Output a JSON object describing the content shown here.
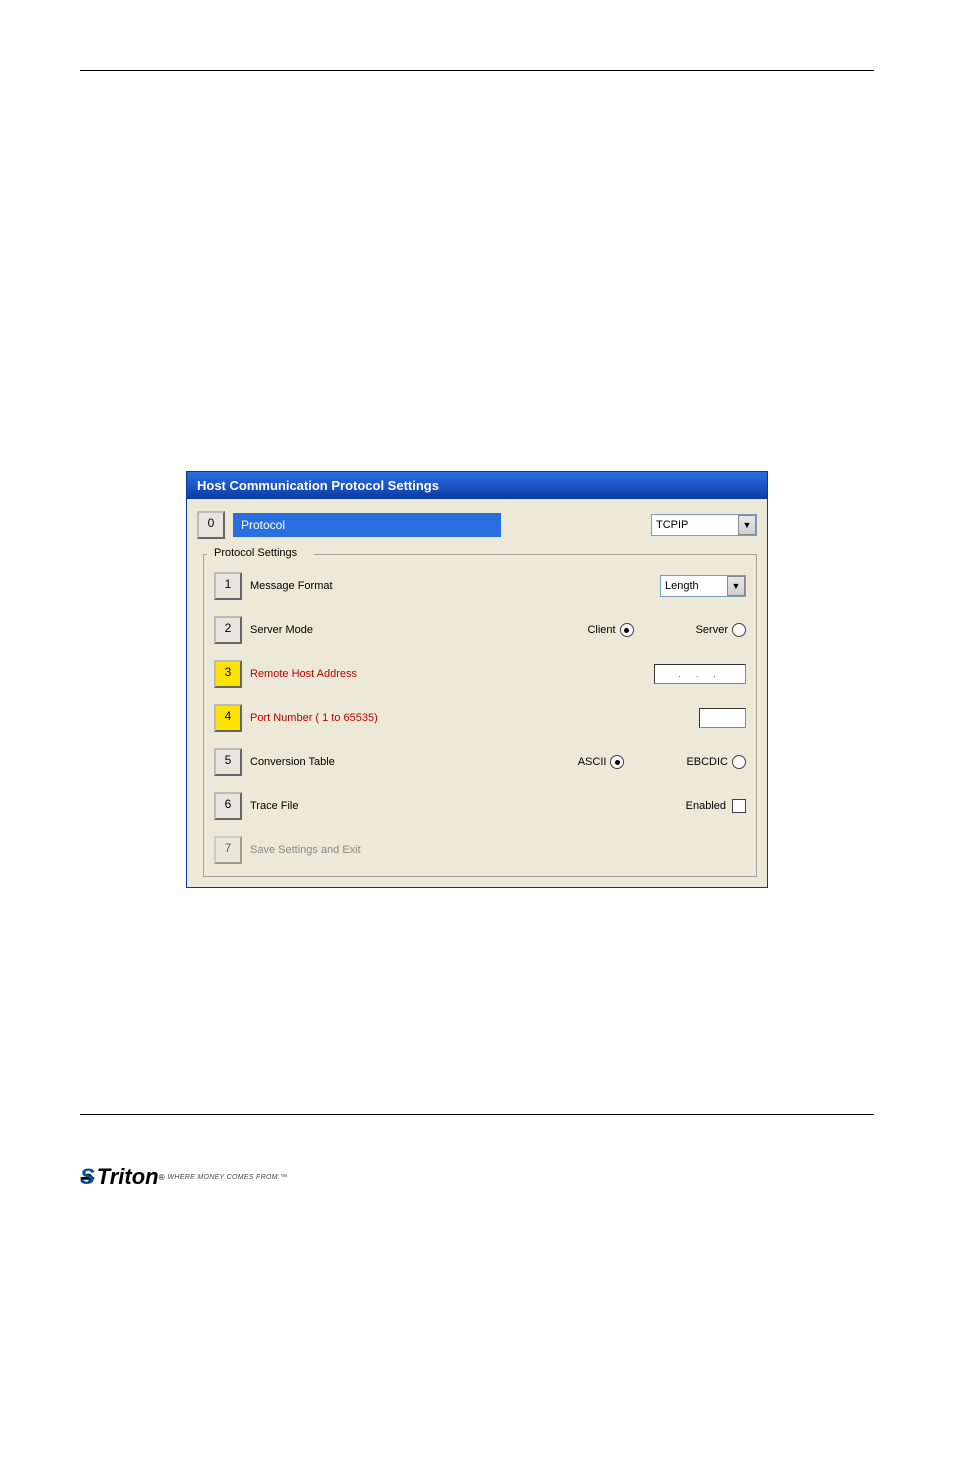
{
  "window": {
    "title": "Host Communication Protocol Settings"
  },
  "protocol": {
    "num": "0",
    "label": "Protocol",
    "value": "TCPIP"
  },
  "fieldset_legend": "Protocol Settings",
  "rows": {
    "message_format": {
      "num": "1",
      "label": "Message Format",
      "value": "Length"
    },
    "server_mode": {
      "num": "2",
      "label": "Server Mode",
      "option_a": "Client",
      "option_b": "Server"
    },
    "remote_host": {
      "num": "3",
      "label": "Remote Host Address",
      "ip_placeholder": ". . ."
    },
    "port": {
      "num": "4",
      "label": "Port Number ( 1 to 65535)"
    },
    "conversion": {
      "num": "5",
      "label": "Conversion Table",
      "option_a": "ASCII",
      "option_b": "EBCDIC"
    },
    "trace": {
      "num": "6",
      "label": "Trace File",
      "chk_label": "Enabled"
    },
    "save": {
      "num": "7",
      "label": "Save Settings and Exit"
    }
  },
  "logo": {
    "brand": "Triton",
    "tag": "WHERE MONEY COMES FROM.™"
  }
}
